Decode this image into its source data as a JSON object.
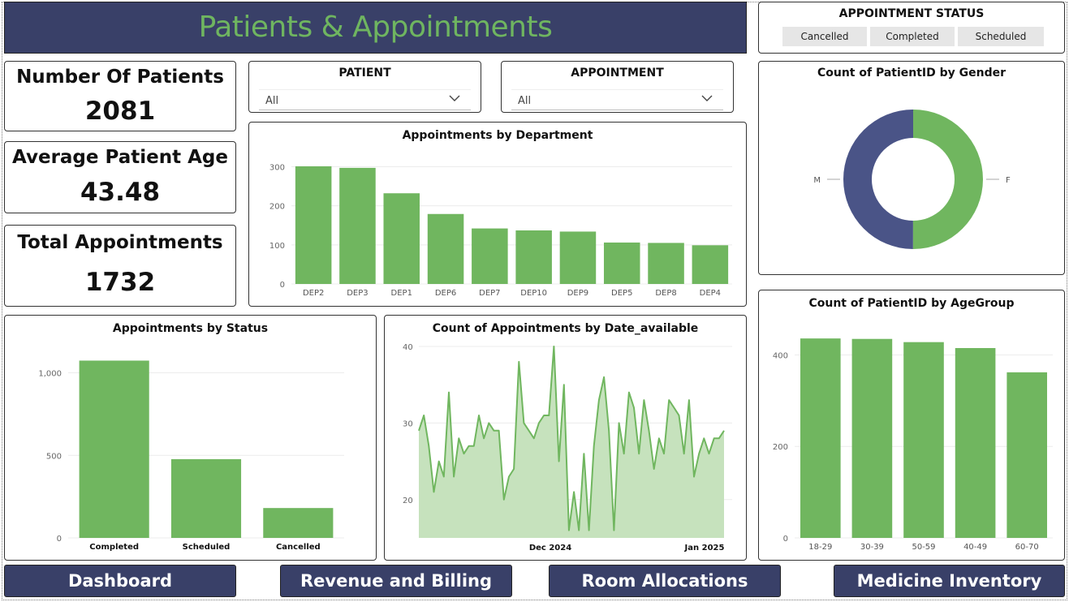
{
  "header": {
    "title": "Patients & Appointments"
  },
  "status_slicer": {
    "title": "APPOINTMENT STATUS",
    "options": [
      "Cancelled",
      "Completed",
      "Scheduled"
    ]
  },
  "kpis": [
    {
      "label": "Number Of Patients",
      "value": "2081"
    },
    {
      "label": "Average Patient Age",
      "value": "43.48"
    },
    {
      "label": "Total Appointments",
      "value": "1732"
    }
  ],
  "filters": {
    "patient": {
      "title": "PATIENT",
      "value": "All"
    },
    "appointment": {
      "title": "APPOINTMENT",
      "value": "All"
    }
  },
  "nav": {
    "dashboard": "Dashboard",
    "revenue": "Revenue and Billing",
    "rooms": "Room Allocations",
    "medicine": "Medicine Inventory"
  },
  "colors": {
    "bar": "#70b65f",
    "navy": "#394068",
    "donut_m": "#4a5487",
    "donut_f": "#70b65f",
    "area_fill": "#c6e2bd"
  },
  "chart_data": [
    {
      "id": "dept",
      "type": "bar",
      "title": "Appointments by Department",
      "categories": [
        "DEP2",
        "DEP3",
        "DEP1",
        "DEP6",
        "DEP7",
        "DEP10",
        "DEP9",
        "DEP5",
        "DEP8",
        "DEP4"
      ],
      "values": [
        301,
        297,
        232,
        179,
        142,
        137,
        134,
        106,
        105,
        99
      ],
      "yticks": [
        "0",
        "100",
        "200",
        "300"
      ],
      "ylim": [
        0,
        330
      ]
    },
    {
      "id": "status",
      "type": "bar",
      "title": "Appointments by Status",
      "categories": [
        "Completed",
        "Scheduled",
        "Cancelled"
      ],
      "values": [
        1074,
        477,
        181
      ],
      "yticks": [
        "0",
        "500",
        "1,000"
      ],
      "ylim": [
        0,
        1150
      ]
    },
    {
      "id": "date",
      "type": "area",
      "title": "Count of Appointments by Date_available",
      "xticks": [
        "Dec 2024",
        "Jan 2025"
      ],
      "yticks": [
        "20",
        "30",
        "40"
      ],
      "ylim": [
        15,
        40
      ],
      "values": [
        29,
        31,
        27,
        21,
        25,
        23,
        34,
        23,
        28,
        26,
        27,
        27,
        31,
        28,
        30,
        29,
        29,
        20,
        23,
        24,
        38,
        30,
        29,
        28,
        30,
        31,
        31,
        40,
        25,
        35,
        16,
        21,
        16,
        26,
        16,
        27,
        33,
        36,
        29,
        16,
        30,
        26,
        34,
        32,
        26,
        33,
        29,
        24,
        28,
        26,
        33,
        32,
        31,
        26,
        33,
        23,
        26,
        28,
        26,
        28,
        28,
        29
      ]
    },
    {
      "id": "gender",
      "type": "pie",
      "title": "Count of PatientID by Gender",
      "labels": [
        "M",
        "F"
      ],
      "values": [
        1040,
        1041
      ]
    },
    {
      "id": "age",
      "type": "bar",
      "title": "Count of PatientID by AgeGroup",
      "categories": [
        "18-29",
        "30-39",
        "50-59",
        "40-49",
        "60-70"
      ],
      "values": [
        436,
        435,
        428,
        415,
        362
      ],
      "yticks": [
        "0",
        "200",
        "400"
      ],
      "ylim": [
        0,
        470
      ]
    }
  ]
}
